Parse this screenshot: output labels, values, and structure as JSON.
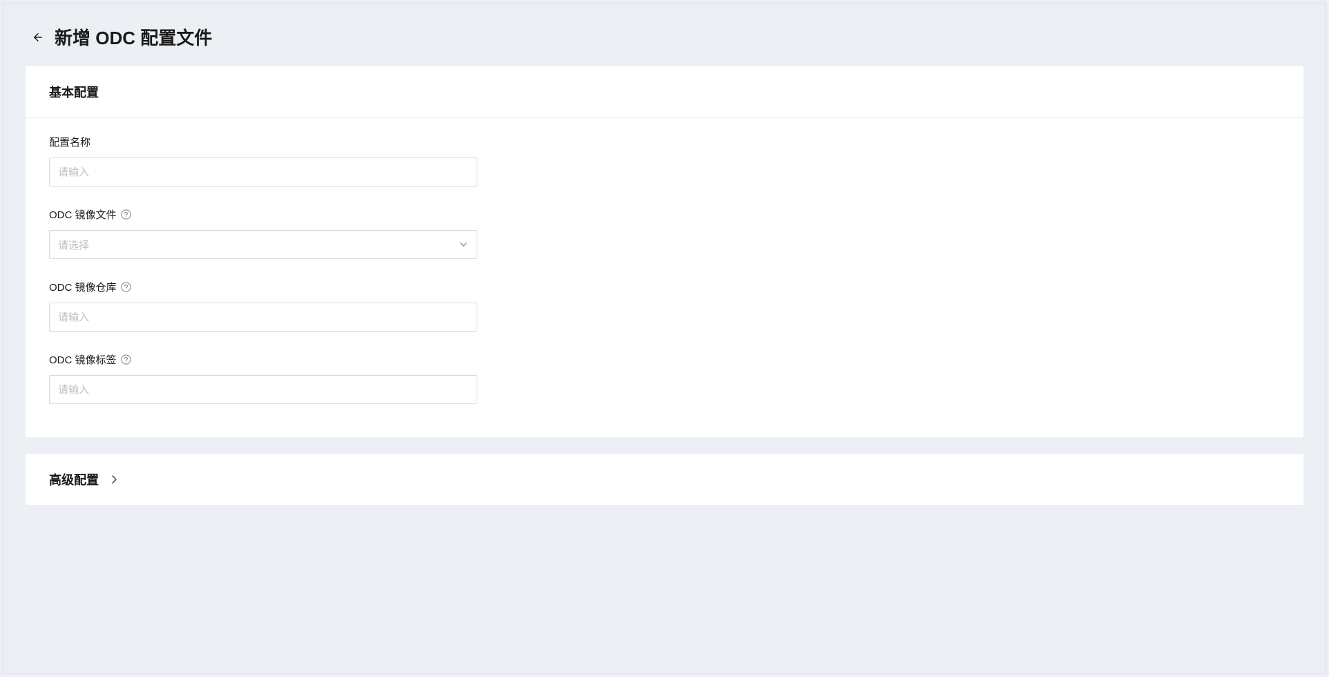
{
  "header": {
    "title": "新增 ODC 配置文件"
  },
  "sections": {
    "basic": {
      "title": "基本配置",
      "fields": {
        "config_name": {
          "label": "配置名称",
          "placeholder": "请输入",
          "value": ""
        },
        "image_file": {
          "label": "ODC 镜像文件",
          "placeholder": "请选择",
          "value": ""
        },
        "image_repo": {
          "label": "ODC 镜像仓库",
          "placeholder": "请输入",
          "value": ""
        },
        "image_tag": {
          "label": "ODC 镜像标签",
          "placeholder": "请输入",
          "value": ""
        }
      }
    },
    "advanced": {
      "title": "高级配置"
    }
  }
}
